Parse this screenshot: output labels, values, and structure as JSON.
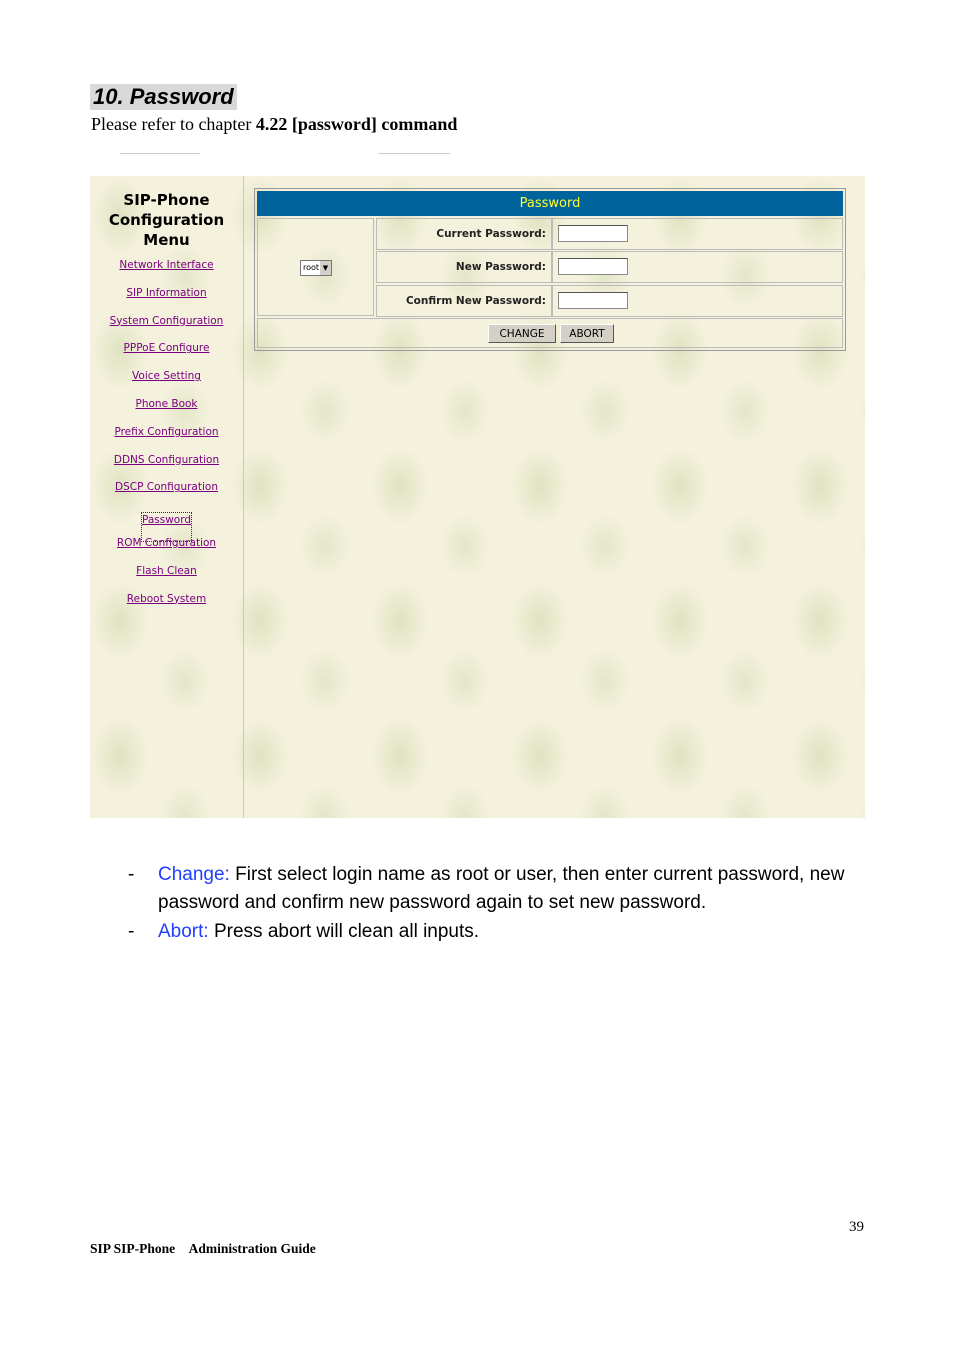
{
  "heading": "10. Password",
  "refer": {
    "prefix": "Please refer to chapter ",
    "bold": "4.22 [password] command"
  },
  "sidebar": {
    "title": "SIP-Phone Configuration Menu",
    "items": [
      {
        "label": "Network Interface"
      },
      {
        "label": "SIP Information"
      },
      {
        "label": "System Configuration"
      },
      {
        "label": "PPPoE Configure"
      },
      {
        "label": "Voice Setting"
      },
      {
        "label": "Phone Book"
      },
      {
        "label": "Prefix Configuration"
      },
      {
        "label": "DDNS Configuration"
      },
      {
        "label": "DSCP Configuration"
      },
      {
        "label": "Password",
        "current": true
      },
      {
        "label": "ROM Configuration"
      },
      {
        "label": "Flash Clean"
      },
      {
        "label": "Reboot System"
      }
    ]
  },
  "panel": {
    "title": "Password",
    "user_select": "root",
    "fields": [
      {
        "label": "Current Password:",
        "value": ""
      },
      {
        "label": "New Password:",
        "value": ""
      },
      {
        "label": "Confirm New Password:",
        "value": ""
      }
    ],
    "change_label": "CHANGE",
    "abort_label": "ABORT"
  },
  "colors": {
    "header_bg": "#00639c",
    "header_text": "#ffff33",
    "link": "#7a0080",
    "keyword": "#1f3fff"
  },
  "bullets": [
    {
      "dash": "-",
      "key": "Change:",
      "text": " First select login name as root or user, then enter current password, new password and confirm new password again to set new password."
    },
    {
      "dash": "-",
      "key": "Abort:",
      "text": " Press abort will clean all inputs."
    }
  ],
  "footer": {
    "page": "39",
    "title": "SIP SIP-Phone　Administration Guide"
  }
}
